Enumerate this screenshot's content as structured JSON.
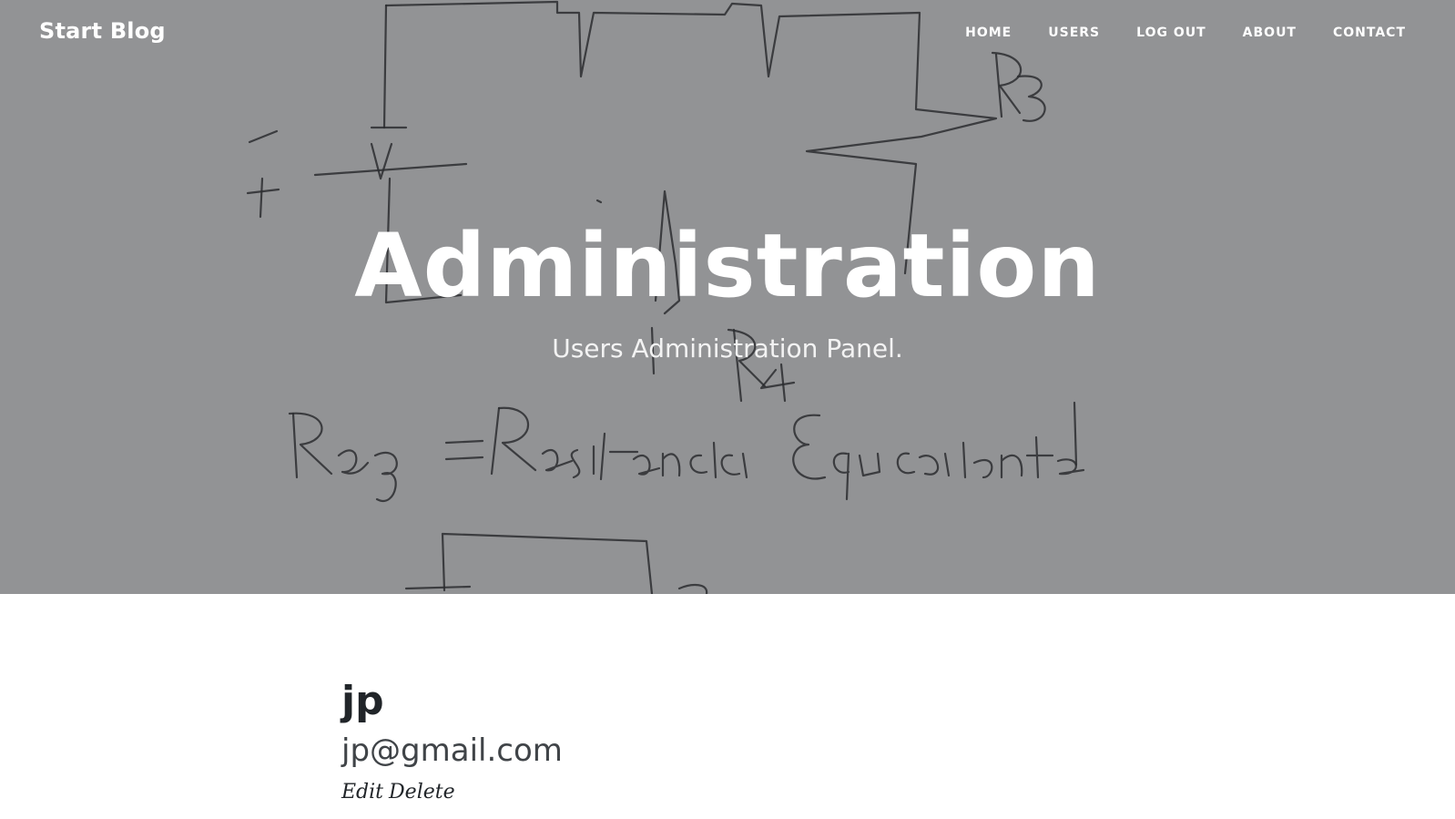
{
  "brand": {
    "label": "Start Blog"
  },
  "nav": {
    "home": "HOME",
    "users": "USERS",
    "logout": "LOG OUT",
    "about": "ABOUT",
    "contact": "CONTACT"
  },
  "hero": {
    "title": "Administration",
    "subtitle": "Users Administration Panel.",
    "background_image": "hand-drawn circuit diagram sketch"
  },
  "colors": {
    "hero_overlay": "#929395",
    "text_dark": "#212529",
    "text_light": "#ffffff"
  },
  "users": [
    {
      "name": "jp",
      "email": "jp@gmail.com",
      "edit_label": "Edit",
      "delete_label": "Delete"
    }
  ]
}
